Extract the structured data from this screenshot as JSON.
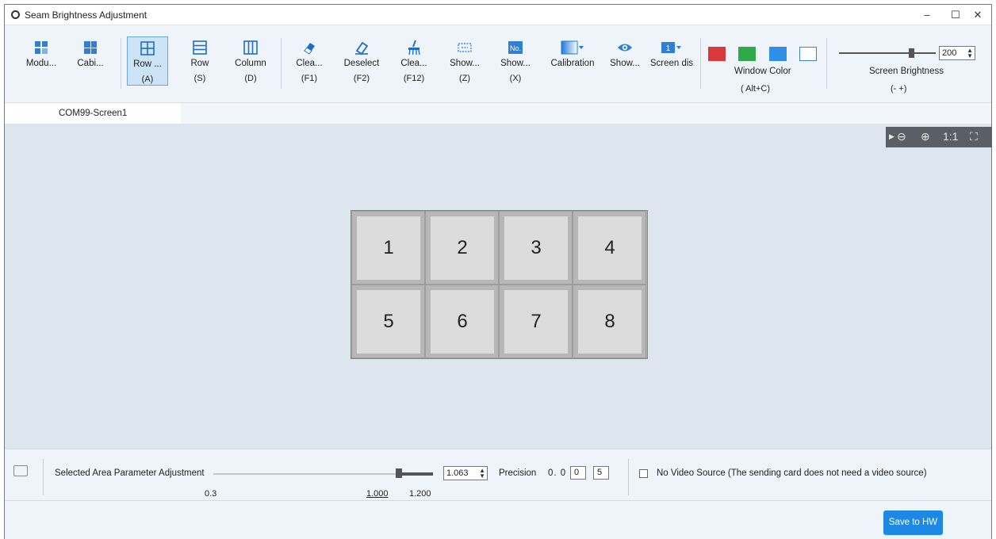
{
  "window": {
    "title": "Seam Brightness Adjustment",
    "minimize": "–",
    "maximize": "☐",
    "close": "✕"
  },
  "toolbar": {
    "buttons": [
      {
        "label": "Modu...",
        "key": ""
      },
      {
        "label": "Cabi...",
        "key": ""
      },
      {
        "label": "Row ...",
        "key": "(A)"
      },
      {
        "label": "Row",
        "key": "(S)"
      },
      {
        "label": "Column",
        "key": "(D)"
      },
      {
        "label": "Clea...",
        "key": "(F1)"
      },
      {
        "label": "Deselect",
        "key": "(F2)"
      },
      {
        "label": "Clea...",
        "key": "(F12)"
      },
      {
        "label": "Show...",
        "key": "(Z)"
      },
      {
        "label": "Show...",
        "key": "(X)"
      },
      {
        "label": "Calibration",
        "key": ""
      },
      {
        "label": "Show...",
        "key": ""
      },
      {
        "label": "Screen dis",
        "key": ""
      }
    ],
    "number_badge": "No.",
    "screen_badge": "1",
    "window_color": {
      "label": "Window Color",
      "key": "( Alt+C)",
      "colors": [
        "#d63a3a",
        "#2eaa4a",
        "#2f8fe8",
        "#ffffff"
      ]
    },
    "brightness": {
      "label": "Screen Brightness",
      "key": "(-  +)",
      "value": "200",
      "level": 200
    }
  },
  "tabs": [
    {
      "label": "COM99-Screen1"
    }
  ],
  "zoom": {
    "zoom_out": "⊖",
    "zoom_in": "⊕",
    "one_to_one": "1:1",
    "fit": "⛶"
  },
  "grid": {
    "cells": [
      "1",
      "2",
      "3",
      "4",
      "5",
      "6",
      "7",
      "8"
    ]
  },
  "param": {
    "label": "Selected Area Parameter Adjustment",
    "min": "0.3",
    "mid": "1.000",
    "max": "1.200",
    "value": "1.063",
    "precision_label": "Precision",
    "precision_prefix": "0. 0",
    "precision_digit1": "0",
    "precision_digit2": "5"
  },
  "no_video": {
    "label": "No Video Source (The sending card does not need a video source)"
  },
  "footer": {
    "save_label": "Save to HW"
  }
}
